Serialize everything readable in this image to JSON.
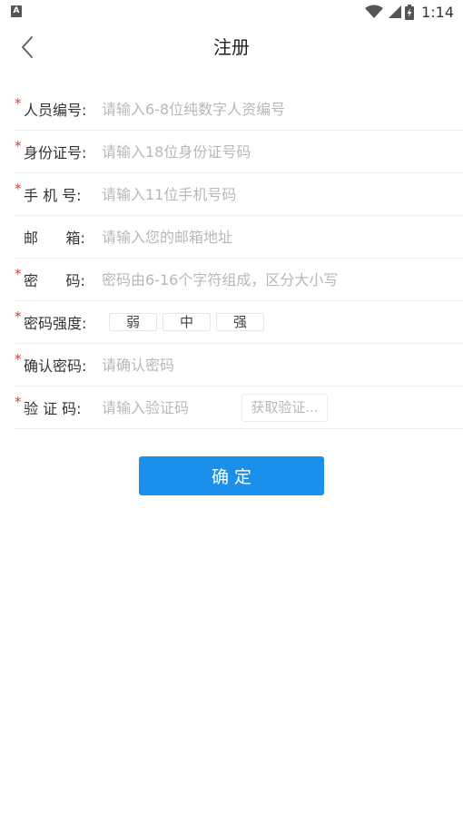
{
  "status_bar": {
    "notification_icon": "A",
    "time": "1:14",
    "icons": [
      "wifi-icon",
      "signal-icon",
      "battery-icon"
    ]
  },
  "nav": {
    "back_icon": "chevron-left-icon",
    "title": "注册"
  },
  "form": {
    "required_mark": "*",
    "employee_id": {
      "label": "人员编号:",
      "placeholder": "请输入6-8位纯数字人资编号"
    },
    "id_card": {
      "label": "身份证号:",
      "placeholder": "请输入18位身份证号码"
    },
    "phone": {
      "label": "手 机 号:",
      "placeholder": "请输入11位手机号码"
    },
    "email": {
      "label": "邮      箱:",
      "placeholder": "请输入您的邮箱地址"
    },
    "password": {
      "label": "密      码:",
      "placeholder": "密码由6-16个字符组成，区分大小写"
    },
    "strength": {
      "label": "密码强度:",
      "levels": [
        "弱",
        "中",
        "强"
      ]
    },
    "confirm_password": {
      "label": "确认密码:",
      "placeholder": "请确认密码"
    },
    "verify_code": {
      "label": "验 证 码:",
      "placeholder": "请输入验证码",
      "button_label": "获取验证..."
    }
  },
  "submit": {
    "label": "确定"
  },
  "colors": {
    "accent": "#1a90ea",
    "required": "#e53935",
    "placeholder": "#b8b8b8",
    "divider": "#eeeeee"
  }
}
